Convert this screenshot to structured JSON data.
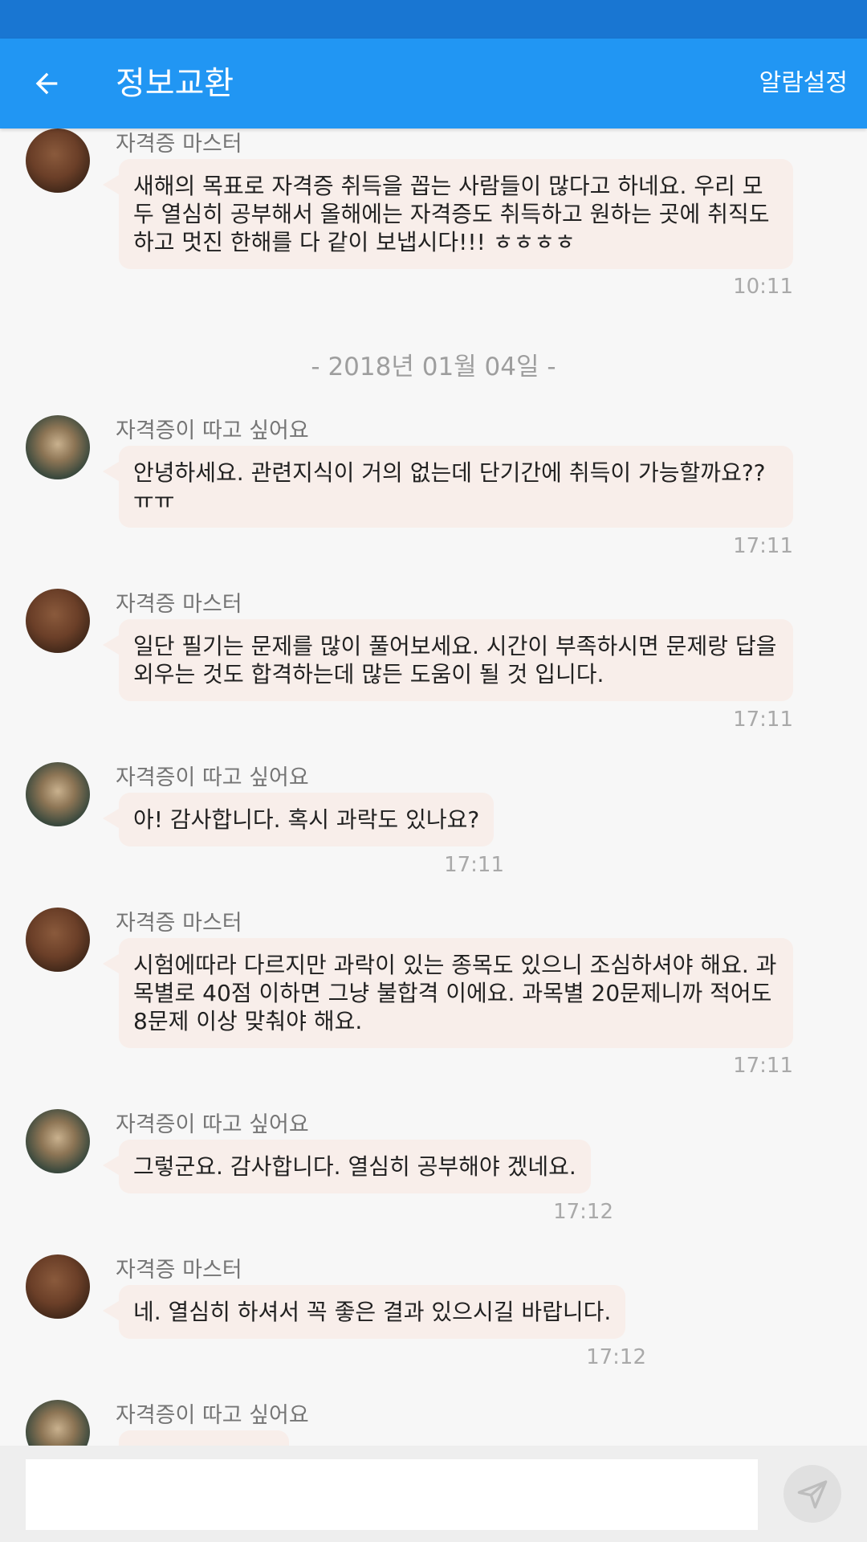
{
  "appbar": {
    "title": "정보교환",
    "alarm_label": "알람설정"
  },
  "date_separator": "- 2018년 01월 04일 -",
  "messages": [
    {
      "sender": "자격증 마스터",
      "text": "새해의 목표로 자격증 취득을 꼽는 사람들이 많다고 하네요. 우리 모두 열심히 공부해서 올해에는 자격증도 취득하고 원하는 곳에 취직도 하고 멋진 한해를 다 같이 보냅시다!!! ㅎㅎㅎㅎ",
      "time": "10:11"
    },
    {
      "sender": "자격증이 따고 싶어요",
      "text": "안녕하세요. 관련지식이 거의 없는데 단기간에 취득이 가능할까요??ㅠㅠ",
      "time": "17:11"
    },
    {
      "sender": "자격증 마스터",
      "text": "일단 필기는 문제를 많이 풀어보세요. 시간이 부족하시면 문제랑 답을 외우는 것도 합격하는데 많든 도움이 될 것 입니다.",
      "time": "17:11"
    },
    {
      "sender": "자격증이 따고 싶어요",
      "text": "아! 감사합니다. 혹시 과락도 있나요?",
      "time": "17:11"
    },
    {
      "sender": "자격증 마스터",
      "text": "시험에따라 다르지만 과락이 있는 종목도 있으니 조심하셔야 해요. 과목별로 40점 이하면 그냥 불합격 이에요. 과목별 20문제니까 적어도 8문제 이상 맞춰야 해요.",
      "time": "17:11"
    },
    {
      "sender": "자격증이 따고 싶어요",
      "text": "그렇군요. 감사합니다. 열심히 공부해야 겠네요.",
      "time": "17:12"
    },
    {
      "sender": "자격증 마스터",
      "text": "네. 열심히 하셔서 꼭 좋은 결과 있으시길 바랍니다.",
      "time": "17:12"
    },
    {
      "sender": "자격증이 따고 싶어요",
      "text": "",
      "time": ""
    }
  ],
  "input": {
    "value": "",
    "placeholder": ""
  },
  "icons": {
    "back": "arrow-back-icon",
    "send": "send-icon"
  },
  "colors": {
    "appbar": "#2196F3",
    "statusbar": "#1976D2",
    "bubble": "#f8eeea"
  }
}
